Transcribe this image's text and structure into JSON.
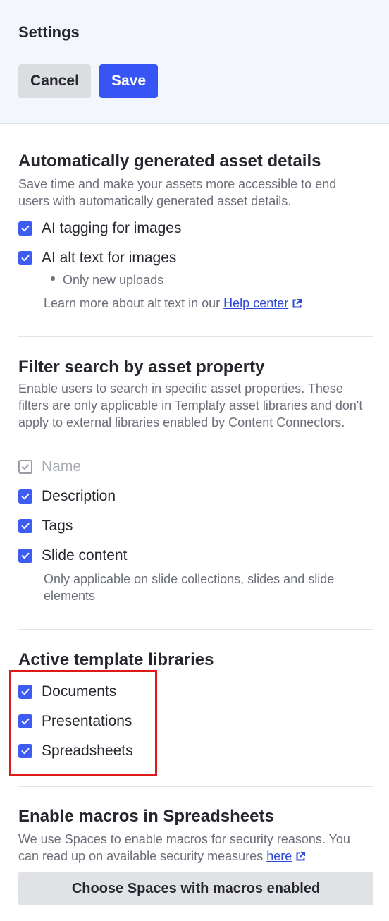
{
  "header": {
    "title": "Settings",
    "cancel_label": "Cancel",
    "save_label": "Save"
  },
  "auto_details": {
    "title": "Automatically generated asset details",
    "description": "Save time and make your assets more accessible to end users with automatically generated asset details.",
    "options": [
      {
        "label": "AI tagging for images",
        "checked": true
      },
      {
        "label": "AI alt text for images",
        "checked": true
      }
    ],
    "bullet": "Only new uploads",
    "learn_more_prefix": "Learn more about alt text in our",
    "learn_more_link": "Help center"
  },
  "filter_search": {
    "title": "Filter search by asset property",
    "description": "Enable users to search in specific asset properties. These filters are only applicable in Templafy asset libraries and don't apply to external libraries enabled by Content Connectors.",
    "options": [
      {
        "label": "Name",
        "checked": true,
        "disabled": true
      },
      {
        "label": "Description",
        "checked": true
      },
      {
        "label": "Tags",
        "checked": true
      },
      {
        "label": "Slide content",
        "checked": true
      }
    ],
    "note": "Only applicable on slide collections, slides and slide elements"
  },
  "template_libraries": {
    "title": "Active template libraries",
    "options": [
      {
        "label": "Documents",
        "checked": true
      },
      {
        "label": "Presentations",
        "checked": true
      },
      {
        "label": "Spreadsheets",
        "checked": true
      }
    ]
  },
  "macros": {
    "title": "Enable macros in Spreadsheets",
    "description_prefix": "We use Spaces to enable macros for security reasons. You can read up on available security measures",
    "description_link": "here",
    "button_label": "Choose Spaces with macros enabled"
  },
  "colors": {
    "accent": "#3755f5",
    "checkbox": "#3f5cf2",
    "highlight": "#dc1a1a",
    "header_bg": "#f3f6fd"
  }
}
